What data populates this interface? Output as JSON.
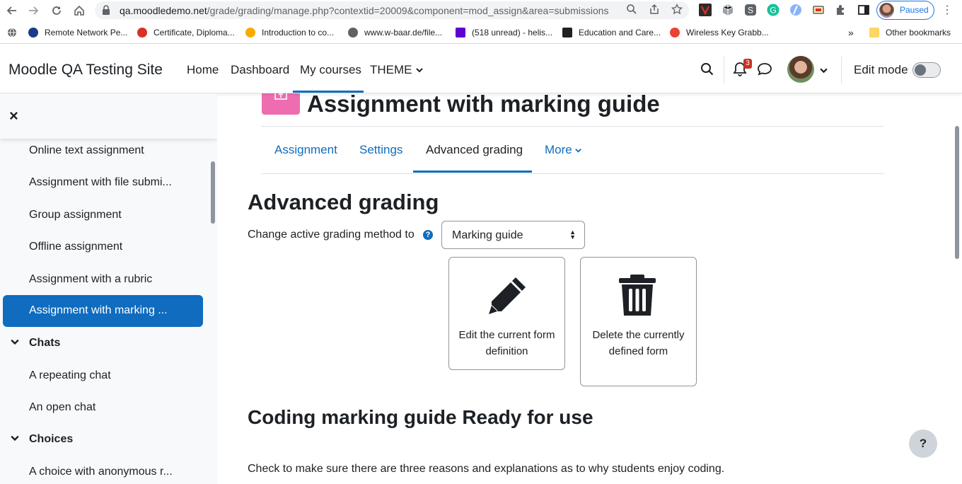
{
  "browser": {
    "url_host": "qa.moodledemo.net",
    "url_path": "/grade/grading/manage.php?contextid=20009&component=mod_assign&area=submissions",
    "profile_status": "Paused",
    "bookmarks": [
      {
        "label": "Remote Network Pe...",
        "icon_color": "#1a3a8a"
      },
      {
        "label": "Certificate, Diploma...",
        "icon_color": "#d93025"
      },
      {
        "label": "Introduction to co...",
        "icon_color": "#f9ab00"
      },
      {
        "label": "www.w-baar.de/file...",
        "icon_color": "#5f6368"
      },
      {
        "label": "(518 unread) - helis...",
        "icon_color": "#6001d2"
      },
      {
        "label": "Education and Care...",
        "icon_color": "#202124"
      },
      {
        "label": "Wireless Key Grabb...",
        "icon_color": "#ea4335"
      }
    ],
    "bookmarks_overflow": "»",
    "other_bookmarks": "Other bookmarks"
  },
  "navbar": {
    "site_name": "Moodle QA Testing Site",
    "links": [
      "Home",
      "Dashboard",
      "My courses",
      "THEME"
    ],
    "active_link": "My courses",
    "notification_count": "3",
    "edit_mode_label": "Edit mode",
    "edit_mode_on": false
  },
  "drawer": {
    "close_icon": "×",
    "items_top": [
      "Online text assignment",
      "Assignment with file submi...",
      "Group assignment",
      "Offline assignment",
      "Assignment with a rubric",
      "Assignment with marking ..."
    ],
    "active_index": 5,
    "sections": [
      {
        "title": "Chats",
        "items": [
          "A repeating chat",
          "An open chat"
        ]
      },
      {
        "title": "Choices",
        "items": [
          "A choice with anonymous r..."
        ]
      }
    ]
  },
  "main": {
    "page_title": "Assignment with marking guide",
    "tabs": [
      "Assignment",
      "Settings",
      "Advanced grading",
      "More"
    ],
    "active_tab": "Advanced grading",
    "heading": "Advanced grading",
    "change_label": "Change active grading method to",
    "help_icon": "?",
    "select_value": "Marking guide",
    "actions": [
      {
        "label": "Edit the current form definition",
        "icon": "pencil-icon"
      },
      {
        "label": "Delete the currently defined form",
        "icon": "trash-icon"
      }
    ],
    "guide_heading": "Coding marking guide Ready for use",
    "guide_description": "Check to make sure there are three reasons and explanations as to why students enjoy coding."
  },
  "help_fab": "?",
  "colors": {
    "primary": "#0f6cbf",
    "activity_icon": "#ee6db1",
    "badge": "#ca3120"
  }
}
